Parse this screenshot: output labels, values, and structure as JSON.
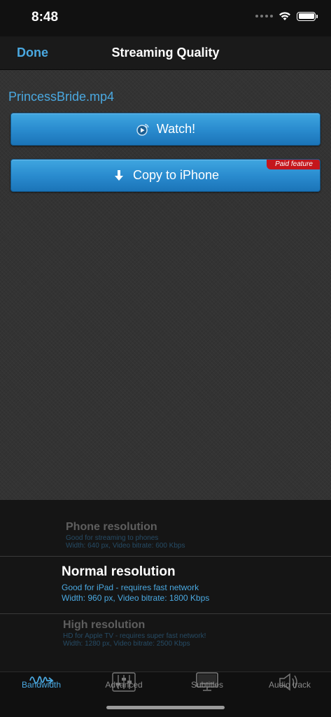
{
  "status_bar": {
    "time": "8:48"
  },
  "nav": {
    "done_label": "Done",
    "title": "Streaming Quality"
  },
  "content": {
    "filename": "PrincessBride.mp4",
    "watch_label": "Watch!",
    "copy_label": "Copy to iPhone",
    "paid_badge": "Paid feature"
  },
  "picker": {
    "selected_index": 1,
    "rows": [
      {
        "title": "Phone resolution",
        "line1": "Good for streaming to phones",
        "line2": "Width: 640 px, Video bitrate: 600 Kbps"
      },
      {
        "title": "Normal resolution",
        "line1": "Good for iPad - requires fast network",
        "line2": "Width: 960 px, Video bitrate: 1800 Kbps"
      },
      {
        "title": "High resolution",
        "line1": "HD for Apple TV - requires super fast network!",
        "line2": "Width: 1280 px, Video bitrate: 2500 Kbps"
      }
    ]
  },
  "tabs": [
    {
      "label": "Bandwidth",
      "icon": "waveform-icon",
      "active": true
    },
    {
      "label": "Advanced",
      "icon": "sliders-icon",
      "active": false
    },
    {
      "label": "Subtitles",
      "icon": "subtitles-icon",
      "active": false
    },
    {
      "label": "Audio track",
      "icon": "speaker-icon",
      "active": false
    }
  ],
  "colors": {
    "accent": "#4aa8e0",
    "button": "#2a8ccf",
    "badge": "#c4161c"
  }
}
